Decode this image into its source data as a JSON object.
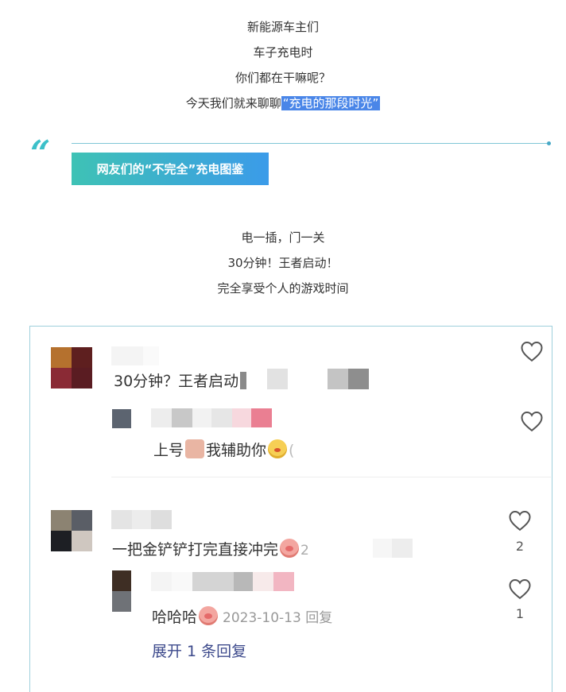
{
  "intro": {
    "line1": "新能源车主们",
    "line2": "车子充电时",
    "line3": "你们都在干嘛呢？",
    "line4_prefix": "今天我们就来聊聊",
    "line4_highlight": "“充电的那段时光”"
  },
  "section": {
    "quote_glyph": "“",
    "title": "网友们的“不完全”充电图鉴"
  },
  "sub_intro": {
    "line1": "电一插，门一关",
    "line2": "30分钟！王者启动！",
    "line3": "完全享受个人的游戏时间"
  },
  "comments": {
    "c1": {
      "text": "30分钟？王者启动"
    },
    "r1": {
      "text_a": "上号",
      "text_b": "我辅助你",
      "trail": "("
    },
    "c2": {
      "text": "一把金铲铲打完直接冲完",
      "trail": "2",
      "likes": "2"
    },
    "r2": {
      "text": "哈哈哈",
      "meta": "2023-10-13 回复",
      "likes": "1"
    },
    "expand": "展开 1 条回复"
  },
  "colors": {
    "accent_teal": "#3cc0c9",
    "accent_blue": "#3b9be9",
    "highlight": "#4a86e8",
    "link": "#3d4a8c"
  },
  "icons": [
    "quote-icon",
    "heart-icon",
    "pig-emoji-icon",
    "chick-emoji-icon",
    "face-emoji-icon"
  ]
}
